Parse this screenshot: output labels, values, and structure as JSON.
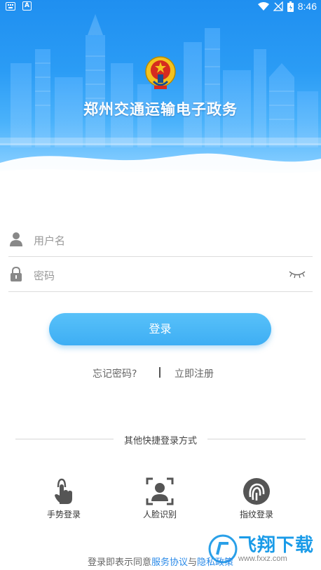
{
  "status_bar": {
    "time": "8:46",
    "left_icons": [
      "keyboard-icon",
      "a-icon"
    ],
    "right_icons": [
      "wifi-icon",
      "no-signal-icon",
      "battery-icon"
    ]
  },
  "hero": {
    "title": "郑州交通运输电子政务",
    "colors": {
      "sky_top": "#1f8ff0",
      "sky_bottom": "#e9f5ff"
    }
  },
  "form": {
    "username_placeholder": "用户名",
    "password_placeholder": "密码",
    "login_label": "登录"
  },
  "links": {
    "forgot": "忘记密码?",
    "register": "立即注册"
  },
  "quick_login": {
    "heading": "其他快捷登录方式",
    "options": [
      {
        "label": "手势登录",
        "icon": "gesture-hand-icon"
      },
      {
        "label": "人脸识别",
        "icon": "face-scan-icon"
      },
      {
        "label": "指纹登录",
        "icon": "fingerprint-icon"
      }
    ]
  },
  "agreement": {
    "prefix": "登录即表示同意",
    "service": "服务协议",
    "and": "与",
    "privacy": "隐私政策"
  },
  "watermark": {
    "text": "飞翔下载",
    "sub": "www.fxxz.com"
  },
  "accent_color": "#3eaef4"
}
